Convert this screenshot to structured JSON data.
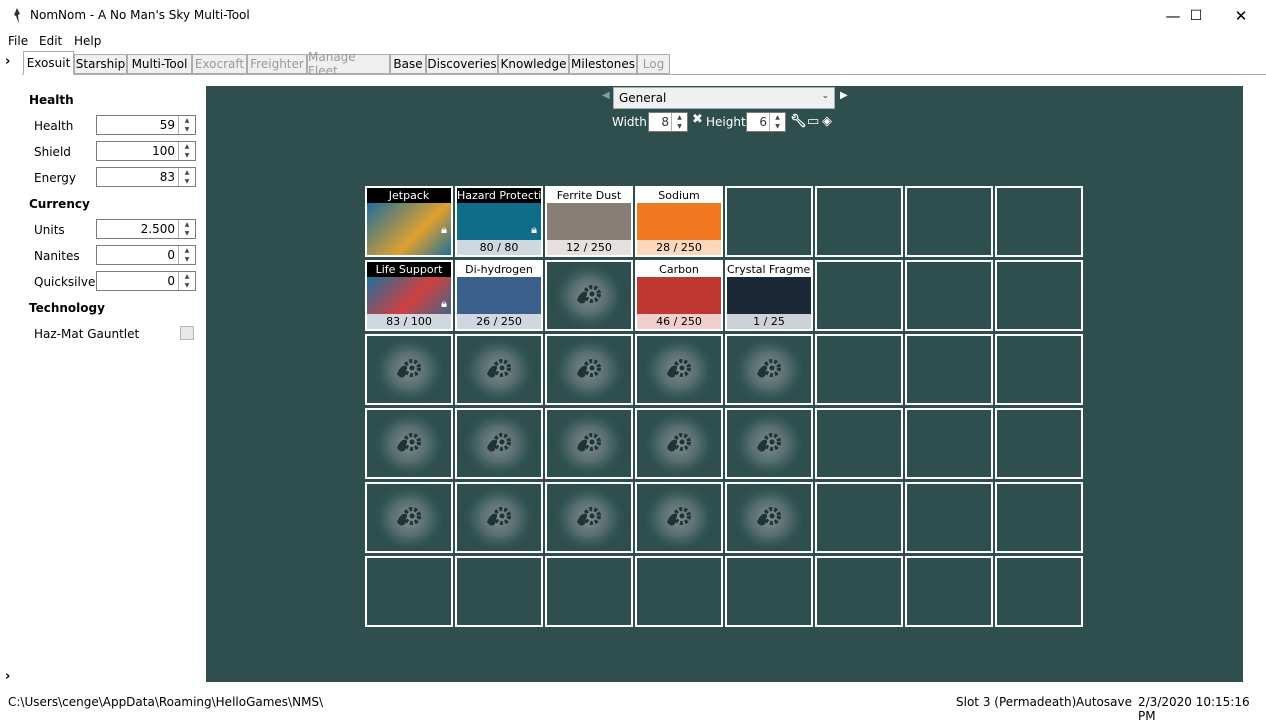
{
  "window": {
    "title": "NomNom - A No Man's Sky Multi-Tool",
    "minimize": "—",
    "maximize": "☐",
    "close": "✕"
  },
  "menu": [
    "File",
    "Edit",
    "Help"
  ],
  "tabs": [
    {
      "label": "Exosuit",
      "state": "active"
    },
    {
      "label": "Starship",
      "state": "enabled"
    },
    {
      "label": "Multi-Tool",
      "state": "enabled"
    },
    {
      "label": "Exocraft",
      "state": "disabled"
    },
    {
      "label": "Freighter",
      "state": "disabled"
    },
    {
      "label": "Manage Fleet",
      "state": "disabled"
    },
    {
      "label": "Base",
      "state": "enabled"
    },
    {
      "label": "Discoveries",
      "state": "enabled"
    },
    {
      "label": "Knowledge",
      "state": "enabled"
    },
    {
      "label": "Milestones",
      "state": "enabled"
    },
    {
      "label": "Log",
      "state": "disabled"
    }
  ],
  "left_panel": {
    "health_header": "Health",
    "health": {
      "label": "Health",
      "value": "59"
    },
    "shield": {
      "label": "Shield",
      "value": "100"
    },
    "energy": {
      "label": "Energy",
      "value": "83"
    },
    "currency_header": "Currency",
    "units": {
      "label": "Units",
      "value": "2.500"
    },
    "nanites": {
      "label": "Nanites",
      "value": "0"
    },
    "quicksilver": {
      "label": "Quicksilver",
      "value": "0"
    },
    "technology_header": "Technology",
    "hazmat": {
      "label": "Haz-Mat Gauntlet",
      "checked": false
    }
  },
  "inventory": {
    "selected": "General",
    "width_label": "Width",
    "width_value": "8",
    "height_label": "Height",
    "height_value": "6",
    "slots_row0": [
      {
        "label": "Jetpack",
        "count": "",
        "style": "jetpack",
        "locked": true
      },
      {
        "label": "Hazard Protection",
        "count": "80 / 80",
        "style": "teal",
        "locked": true
      },
      {
        "label": "Ferrite Dust",
        "count": "12 / 250",
        "style": "ferrite"
      },
      {
        "label": "Sodium",
        "count": "28 / 250",
        "style": "sodium"
      }
    ],
    "slots_row1": [
      {
        "label": "Life Support",
        "count": "83 / 100",
        "style": "lifesupport",
        "locked": true
      },
      {
        "label": "Di-hydrogen",
        "count": "26 / 250",
        "style": "dihydrogen"
      },
      {
        "label": "",
        "count": "",
        "style": "gear"
      },
      {
        "label": "Carbon",
        "count": "46 / 250",
        "style": "carbon"
      },
      {
        "label": "Crystal Fragment",
        "count": "1 / 25",
        "style": "crystal"
      }
    ]
  },
  "status": {
    "path": "C:\\Users\\cenge\\AppData\\Roaming\\HelloGames\\NMS\\",
    "slot": "Slot 3 (Permadeath)",
    "mode": "Autosave",
    "datetime": "2/3/2020 10:15:16 PM"
  }
}
